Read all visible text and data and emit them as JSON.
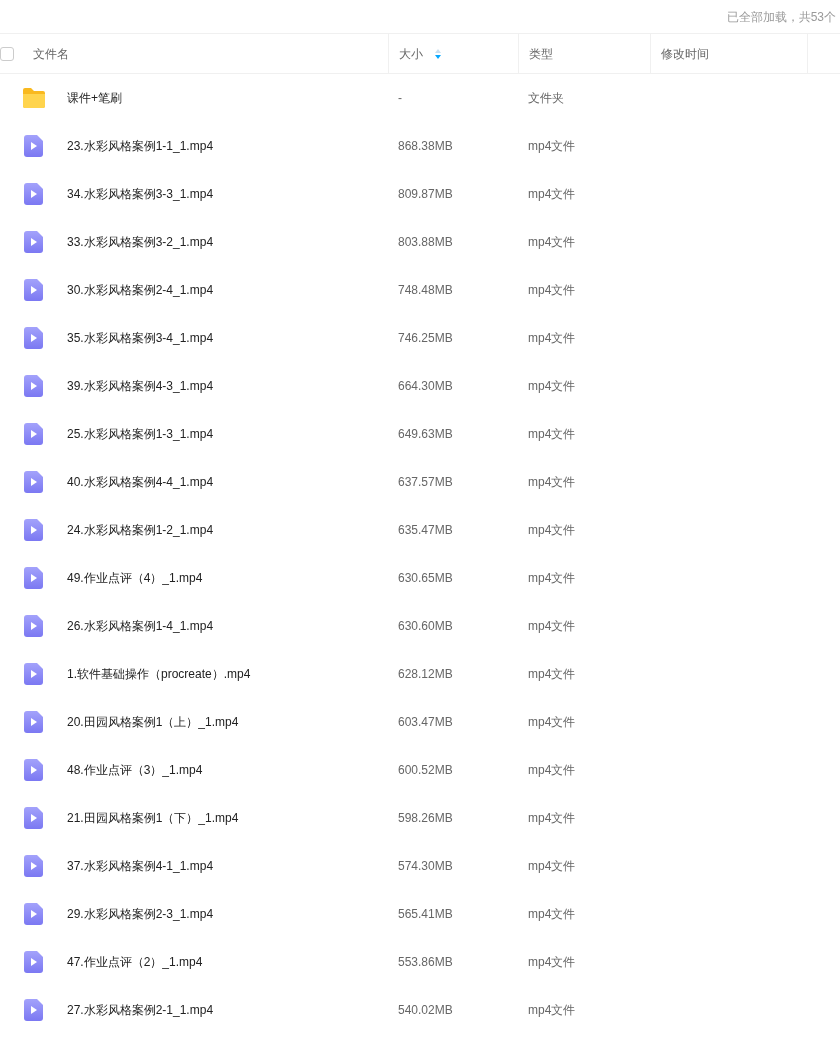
{
  "status": "已全部加载，共53个",
  "header": {
    "checkbox": {
      "checked": false
    },
    "columns": [
      {
        "label": "文件名",
        "sorted": false
      },
      {
        "label": "大小",
        "sorted": true
      },
      {
        "label": "类型",
        "sorted": false
      },
      {
        "label": "修改时间",
        "sorted": false
      }
    ]
  },
  "rows": [
    {
      "kind": "folder",
      "name": "课件+笔刷",
      "size": "-",
      "type": "文件夹"
    },
    {
      "kind": "video",
      "name": "23.水彩风格案例1-1_1.mp4",
      "size": "868.38MB",
      "type": "mp4文件"
    },
    {
      "kind": "video",
      "name": "34.水彩风格案例3-3_1.mp4",
      "size": "809.87MB",
      "type": "mp4文件"
    },
    {
      "kind": "video",
      "name": "33.水彩风格案例3-2_1.mp4",
      "size": "803.88MB",
      "type": "mp4文件"
    },
    {
      "kind": "video",
      "name": "30.水彩风格案例2-4_1.mp4",
      "size": "748.48MB",
      "type": "mp4文件"
    },
    {
      "kind": "video",
      "name": "35.水彩风格案例3-4_1.mp4",
      "size": "746.25MB",
      "type": "mp4文件"
    },
    {
      "kind": "video",
      "name": "39.水彩风格案例4-3_1.mp4",
      "size": "664.30MB",
      "type": "mp4文件"
    },
    {
      "kind": "video",
      "name": "25.水彩风格案例1-3_1.mp4",
      "size": "649.63MB",
      "type": "mp4文件"
    },
    {
      "kind": "video",
      "name": "40.水彩风格案例4-4_1.mp4",
      "size": "637.57MB",
      "type": "mp4文件"
    },
    {
      "kind": "video",
      "name": "24.水彩风格案例1-2_1.mp4",
      "size": "635.47MB",
      "type": "mp4文件"
    },
    {
      "kind": "video",
      "name": "49.作业点评（4）_1.mp4",
      "size": "630.65MB",
      "type": "mp4文件"
    },
    {
      "kind": "video",
      "name": "26.水彩风格案例1-4_1.mp4",
      "size": "630.60MB",
      "type": "mp4文件"
    },
    {
      "kind": "video",
      "name": "1.软件基础操作（procreate）.mp4",
      "size": "628.12MB",
      "type": "mp4文件"
    },
    {
      "kind": "video",
      "name": "20.田园风格案例1（上）_1.mp4",
      "size": "603.47MB",
      "type": "mp4文件"
    },
    {
      "kind": "video",
      "name": "48.作业点评（3）_1.mp4",
      "size": "600.52MB",
      "type": "mp4文件"
    },
    {
      "kind": "video",
      "name": "21.田园风格案例1（下）_1.mp4",
      "size": "598.26MB",
      "type": "mp4文件"
    },
    {
      "kind": "video",
      "name": "37.水彩风格案例4-1_1.mp4",
      "size": "574.30MB",
      "type": "mp4文件"
    },
    {
      "kind": "video",
      "name": "29.水彩风格案例2-3_1.mp4",
      "size": "565.41MB",
      "type": "mp4文件"
    },
    {
      "kind": "video",
      "name": "47.作业点评（2）_1.mp4",
      "size": "553.86MB",
      "type": "mp4文件"
    },
    {
      "kind": "video",
      "name": "27.水彩风格案例2-1_1.mp4",
      "size": "540.02MB",
      "type": "mp4文件"
    }
  ]
}
